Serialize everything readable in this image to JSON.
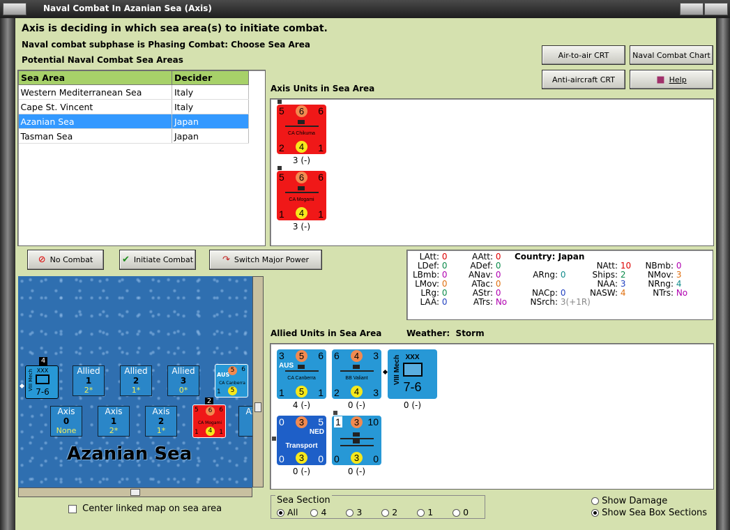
{
  "window": {
    "title": "Naval Combat In Azanian Sea (Axis)"
  },
  "header": {
    "line1": "Axis is deciding in which sea area(s) to initiate combat.",
    "line2": "Naval combat subphase is Phasing Combat: Choose Sea Area",
    "line3": "Potential Naval Combat Sea Areas"
  },
  "buttons": {
    "air_to_air": "Air-to-air CRT",
    "naval_chart": "Naval Combat Chart",
    "anti_aircraft": "Anti-aircraft CRT",
    "help": "Help",
    "no_combat": "No Combat",
    "initiate_combat": "Initiate Combat",
    "switch_major": "Switch Major Power"
  },
  "sea_table": {
    "headers": [
      "Sea Area",
      "Decider"
    ],
    "rows": [
      [
        "Western Mediterranean Sea",
        "Italy"
      ],
      [
        "Cape St. Vincent",
        "Italy"
      ],
      [
        "Azanian Sea",
        "Japan"
      ],
      [
        "Tasman Sea",
        "Japan"
      ]
    ]
  },
  "axis_units": {
    "label": "Axis Units in Sea Area",
    "counters": [
      {
        "name": "CA Chikuma",
        "tl": "5",
        "tc": "6",
        "tr": "6",
        "bl": "2",
        "bc": "4",
        "br": "1",
        "strength": "3 (-)"
      },
      {
        "name": "CA Mogami",
        "tl": "5",
        "tc": "6",
        "tr": "6",
        "bl": "1",
        "bc": "4",
        "br": "1",
        "strength": "3 (-)"
      }
    ]
  },
  "stats": {
    "LAtt": "0",
    "LDef": "0",
    "LBmb": "0",
    "LMov": "0",
    "LRg": "0",
    "LAA": "0",
    "AAtt": "0",
    "ADef": "0",
    "ANav": "0",
    "ATac": "0",
    "AStr": "0",
    "ATrs": "No",
    "country_label": "Country:",
    "country": "Japan",
    "ARng": "0",
    "NACp": "0",
    "NSrch": "3(+1R)",
    "NAtt": "10",
    "Ships": "2",
    "NAA": "3",
    "NASW": "4",
    "NBmb": "0",
    "NMov": "3",
    "NRng": "4",
    "NTrs": "No"
  },
  "allied_units": {
    "label": "Allied Units in Sea Area",
    "weather_label": "Weather:",
    "weather": "Storm",
    "counters": [
      {
        "name": "CA Canberra",
        "tag": "AUS",
        "tl": "3",
        "tc": "5",
        "tr": "6",
        "bl": "1",
        "bc": "5",
        "br": "1",
        "strength": "4 (-)"
      },
      {
        "name": "BB Valiant",
        "tl": "6",
        "tc": "4",
        "tr": "3",
        "bl": "2",
        "bc": "4",
        "br": "3",
        "strength": "0 (-)"
      },
      {
        "name": "VIII Mech",
        "top": "XXX",
        "value": "7-6",
        "strength": "0 (-)"
      },
      {
        "name": "Transport",
        "tag": "NED",
        "tl": "0",
        "tc": "3",
        "tr": "5",
        "bl": "0",
        "bc": "3",
        "br": "0",
        "strength": "0 (-)"
      },
      {
        "name": "",
        "tl": "1",
        "tc": "3",
        "tr": "10",
        "bl": "0",
        "bc": "3",
        "br": "0",
        "strength": "0 (-)"
      }
    ]
  },
  "map": {
    "sea_name": "Azanian Sea",
    "allied_boxes": [
      {
        "title": "Allied",
        "n": "1",
        "v": "2*"
      },
      {
        "title": "Allied",
        "n": "2",
        "v": "1*"
      },
      {
        "title": "Allied",
        "n": "3",
        "v": "0*"
      }
    ],
    "axis_boxes": [
      {
        "title": "Axis",
        "n": "0",
        "v": "None"
      },
      {
        "title": "Axis",
        "n": "1",
        "v": "2*"
      },
      {
        "title": "Axis",
        "n": "2",
        "v": "1*"
      }
    ],
    "mech_badge": "4",
    "axis_stack_badge": "2",
    "aus_tag": "AUS",
    "mech_value": "7-6",
    "mech_top": "XXX",
    "mech_name": "VIII Mech",
    "mini_aus_name": "CA Canberra",
    "mini_axis_name": "CA Mogami"
  },
  "footer": {
    "center_label": "Center linked map on sea area",
    "sea_section_label": "Sea Section",
    "sections": [
      "All",
      "4",
      "3",
      "2",
      "1",
      "0"
    ],
    "show_damage": "Show Damage",
    "show_sections": "Show Sea Box Sections"
  }
}
